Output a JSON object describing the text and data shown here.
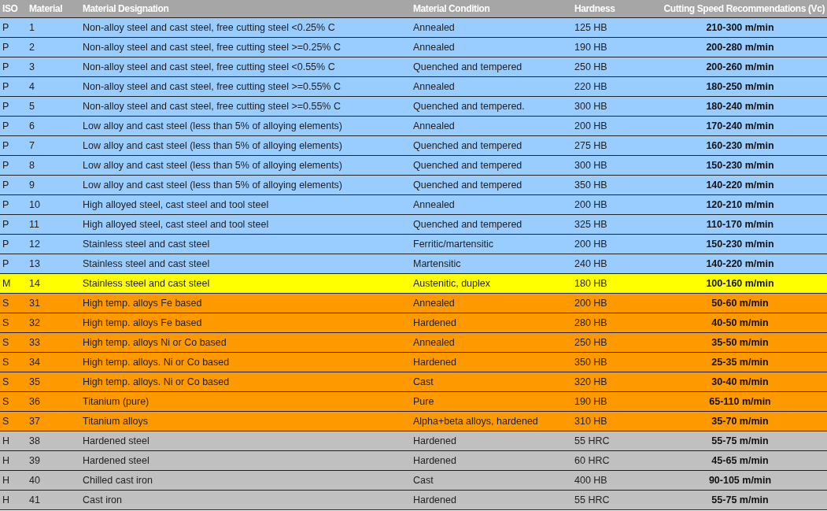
{
  "table": {
    "columns": [
      "ISO",
      "Material",
      "Material Designation",
      "Material Condition",
      "Hardness",
      "Cutting Speed Recommendations (Vc)"
    ],
    "rows": [
      {
        "iso": "P",
        "material": "1",
        "designation": "Non-alloy steel and cast steel, free cutting steel <0.25% C",
        "condition": "Annealed",
        "hardness": "125 HB",
        "speed": "210-300 m/min",
        "color": "#99ccff"
      },
      {
        "iso": "P",
        "material": "2",
        "designation": "Non-alloy steel and cast steel, free cutting steel >=0.25% C",
        "condition": "Annealed",
        "hardness": "190 HB",
        "speed": "200-280 m/min",
        "color": "#99ccff"
      },
      {
        "iso": "P",
        "material": "3",
        "designation": "Non-alloy steel and cast steel, free cutting steel <0.55% C",
        "condition": "Quenched and tempered",
        "hardness": "250 HB",
        "speed": "200-260 m/min",
        "color": "#99ccff"
      },
      {
        "iso": "P",
        "material": "4",
        "designation": "Non-alloy steel and cast steel, free cutting steel >=0.55% C",
        "condition": "Annealed",
        "hardness": "220 HB",
        "speed": "180-250 m/min",
        "color": "#99ccff"
      },
      {
        "iso": "P",
        "material": "5",
        "designation": "Non-alloy steel and cast steel, free cutting steel >=0.55% C",
        "condition": "Quenched and tempered.",
        "hardness": "300 HB",
        "speed": "180-240 m/min",
        "color": "#99ccff"
      },
      {
        "iso": "P",
        "material": "6",
        "designation": "Low alloy and cast steel (less than 5% of alloying elements)",
        "condition": "Annealed",
        "hardness": "200 HB",
        "speed": "170-240 m/min",
        "color": "#99ccff"
      },
      {
        "iso": "P",
        "material": "7",
        "designation": "Low alloy and cast steel (less than 5% of alloying elements)",
        "condition": "Quenched and tempered",
        "hardness": "275 HB",
        "speed": "160-230 m/min",
        "color": "#99ccff"
      },
      {
        "iso": "P",
        "material": "8",
        "designation": "Low alloy and cast steel (less than 5% of alloying elements)",
        "condition": "Quenched and tempered",
        "hardness": "300 HB",
        "speed": "150-230 m/min",
        "color": "#99ccff"
      },
      {
        "iso": "P",
        "material": "9",
        "designation": "Low alloy and cast steel (less than 5% of alloying elements)",
        "condition": "Quenched and tempered",
        "hardness": "350 HB",
        "speed": "140-220 m/min",
        "color": "#99ccff"
      },
      {
        "iso": "P",
        "material": "10",
        "designation": "High alloyed steel, cast steel and tool steel",
        "condition": "Annealed",
        "hardness": "200 HB",
        "speed": "120-210 m/min",
        "color": "#99ccff"
      },
      {
        "iso": "P",
        "material": "11",
        "designation": "High alloyed steel, cast steel and tool steel",
        "condition": "Quenched and tempered",
        "hardness": "325 HB",
        "speed": "110-170 m/min",
        "color": "#99ccff"
      },
      {
        "iso": "P",
        "material": "12",
        "designation": "Stainless steel and cast steel",
        "condition": "Ferritic/martensitic",
        "hardness": "200 HB",
        "speed": "150-230 m/min",
        "color": "#99ccff"
      },
      {
        "iso": "P",
        "material": "13",
        "designation": "Stainless steel and cast steel",
        "condition": "Martensitic",
        "hardness": "240 HB",
        "speed": "140-220 m/min",
        "color": "#99ccff"
      },
      {
        "iso": "M",
        "material": "14",
        "designation": "Stainless steel and cast steel",
        "condition": "Austenitic, duplex",
        "hardness": "180 HB",
        "speed": "100-160 m/min",
        "color": "#ffff00"
      },
      {
        "iso": "S",
        "material": "31",
        "designation": "High temp. alloys Fe based",
        "condition": "Annealed",
        "hardness": "200 HB",
        "speed": "50-60 m/min",
        "color": "#ff9900"
      },
      {
        "iso": "S",
        "material": "32",
        "designation": "High temp. alloys Fe based",
        "condition": "Hardened",
        "hardness": "280 HB",
        "speed": "40-50 m/min",
        "color": "#ff9900"
      },
      {
        "iso": "S",
        "material": "33",
        "designation": "High temp. alloys Ni or Co based",
        "condition": "Annealed",
        "hardness": "250 HB",
        "speed": "35-50 m/min",
        "color": "#ff9900"
      },
      {
        "iso": "S",
        "material": "34",
        "designation": "High temp. alloys. Ni or Co based",
        "condition": "Hardened",
        "hardness": "350 HB",
        "speed": "25-35 m/min",
        "color": "#ff9900"
      },
      {
        "iso": "S",
        "material": "35",
        "designation": "High temp. alloys. Ni or Co based",
        "condition": "Cast",
        "hardness": "320 HB",
        "speed": "30-40 m/min",
        "color": "#ff9900"
      },
      {
        "iso": "S",
        "material": "36",
        "designation": "Titanium (pure)",
        "condition": "Pure",
        "hardness": "190 HB",
        "speed": "65-110 m/min",
        "color": "#ff9900"
      },
      {
        "iso": "S",
        "material": "37",
        "designation": "Titanium alloys",
        "condition": "Alpha+beta alloys, hardened",
        "hardness": "310 HB",
        "speed": "35-70 m/min",
        "color": "#ff9900"
      },
      {
        "iso": "H",
        "material": "38",
        "designation": "Hardened steel",
        "condition": "Hardened",
        "hardness": "55 HRC",
        "speed": "55-75 m/min",
        "color": "#c0c0c0"
      },
      {
        "iso": "H",
        "material": "39",
        "designation": "Hardened steel",
        "condition": "Hardened",
        "hardness": "60 HRC",
        "speed": "45-65 m/min",
        "color": "#c0c0c0"
      },
      {
        "iso": "H",
        "material": "40",
        "designation": "Chilled cast iron",
        "condition": "Cast",
        "hardness": "400 HB",
        "speed": "90-105 m/min",
        "color": "#c0c0c0"
      },
      {
        "iso": "H",
        "material": "41",
        "designation": "Cast iron",
        "condition": "Hardened",
        "hardness": "55 HRC",
        "speed": "55-75 m/min",
        "color": "#c0c0c0"
      }
    ]
  }
}
